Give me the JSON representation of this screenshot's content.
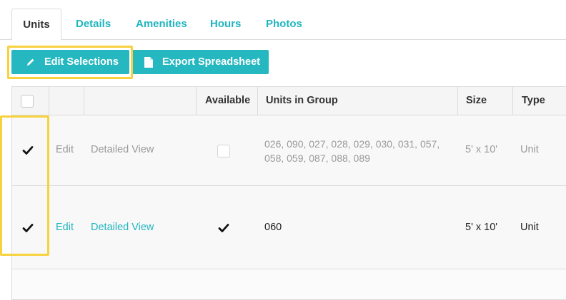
{
  "tabs": [
    {
      "label": "Units",
      "active": true
    },
    {
      "label": "Details",
      "active": false
    },
    {
      "label": "Amenities",
      "active": false
    },
    {
      "label": "Hours",
      "active": false
    },
    {
      "label": "Photos",
      "active": false
    }
  ],
  "toolbar": {
    "edit_label": "Edit Selections",
    "export_label": "Export Spreadsheet",
    "edit_icon": "pencil-icon",
    "export_icon": "document-icon"
  },
  "table": {
    "columns": [
      "",
      "",
      "",
      "Available",
      "Units in Group",
      "Size",
      "Type"
    ],
    "rows": [
      {
        "selected": true,
        "edit": "Edit",
        "view": "Detailed View",
        "available": false,
        "units": "026, 090, 027, 028, 029, 030, 031, 057, 058, 059, 087, 088, 089",
        "size": "5' x 10'",
        "type": "Unit"
      },
      {
        "selected": true,
        "edit": "Edit",
        "view": "Detailed View",
        "available": true,
        "units": "060",
        "size": "5' x 10'",
        "type": "Unit"
      }
    ]
  },
  "colors": {
    "accent": "#26b8c1",
    "link": "#20b5c0",
    "highlight": "#f7d23e"
  }
}
